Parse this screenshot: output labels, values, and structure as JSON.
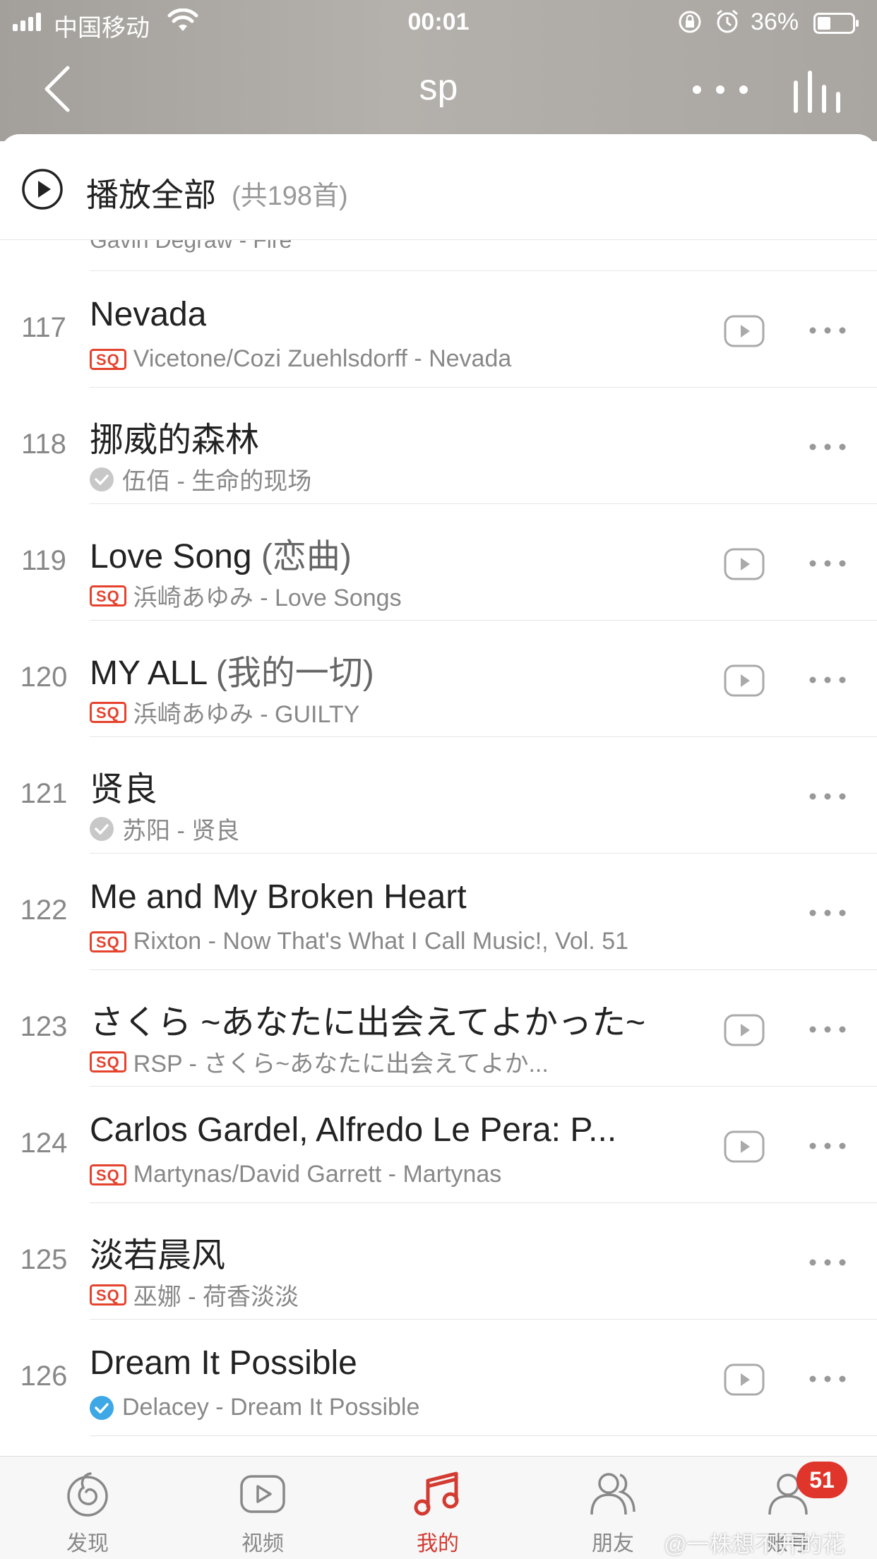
{
  "status_bar": {
    "carrier": "中国移动",
    "time": "00:01",
    "battery": "36%"
  },
  "nav": {
    "title": "sp"
  },
  "play_all": {
    "label": "播放全部",
    "count": "(共198首)"
  },
  "partial_row": {
    "meta": "Gavin Degraw - Fire"
  },
  "songs": [
    {
      "index": "117",
      "title": "Nevada",
      "title_sub": "",
      "meta": "Vicetone/Cozi Zuehlsdorff - Nevada",
      "badge": "sq",
      "has_play": true
    },
    {
      "index": "118",
      "title": "挪威的森林",
      "title_sub": "",
      "meta": "伍佰 - 生命的现场",
      "badge": "check-gray",
      "has_play": false
    },
    {
      "index": "119",
      "title": "Love Song ",
      "title_sub": "(恋曲)",
      "meta": "浜崎あゆみ - Love Songs",
      "badge": "sq",
      "has_play": true
    },
    {
      "index": "120",
      "title": "MY ALL ",
      "title_sub": "(我的一切)",
      "meta": "浜崎あゆみ - GUILTY",
      "badge": "sq",
      "has_play": true
    },
    {
      "index": "121",
      "title": "贤良",
      "title_sub": "",
      "meta": "苏阳 - 贤良",
      "badge": "check-gray",
      "has_play": false
    },
    {
      "index": "122",
      "title": "Me and My Broken Heart",
      "title_sub": "",
      "meta": "Rixton - Now That's What I Call Music!, Vol. 51",
      "badge": "sq",
      "has_play": false
    },
    {
      "index": "123",
      "title": "さくら ~あなたに出会えてよかった~",
      "title_sub": "",
      "meta": "RSP - さくら~あなたに出会えてよか...",
      "badge": "sq",
      "has_play": true
    },
    {
      "index": "124",
      "title": "Carlos Gardel, Alfredo Le Pera: P...",
      "title_sub": "",
      "meta": "Martynas/David Garrett - Martynas",
      "badge": "sq",
      "has_play": true
    },
    {
      "index": "125",
      "title": "淡若晨风",
      "title_sub": "",
      "meta": "巫娜 - 荷香淡淡",
      "badge": "sq",
      "has_play": false
    },
    {
      "index": "126",
      "title": "Dream It Possible",
      "title_sub": "",
      "meta": "Delacey - Dream It Possible",
      "badge": "check-blue",
      "has_play": true
    }
  ],
  "sq_label": "SQ",
  "tabs": [
    {
      "label": "发现",
      "icon": "discover-icon"
    },
    {
      "label": "视频",
      "icon": "video-icon"
    },
    {
      "label": "我的",
      "icon": "music-note-icon",
      "active": true
    },
    {
      "label": "朋友",
      "icon": "friends-icon"
    },
    {
      "label": "账号",
      "icon": "account-icon"
    }
  ],
  "account_badge": "51",
  "watermark": "@一株想不开的花",
  "colors": {
    "accent": "#d33a31",
    "sq": "#e5432d",
    "check_blue": "#3ea7e6",
    "check_gray": "#c8c8c8"
  }
}
